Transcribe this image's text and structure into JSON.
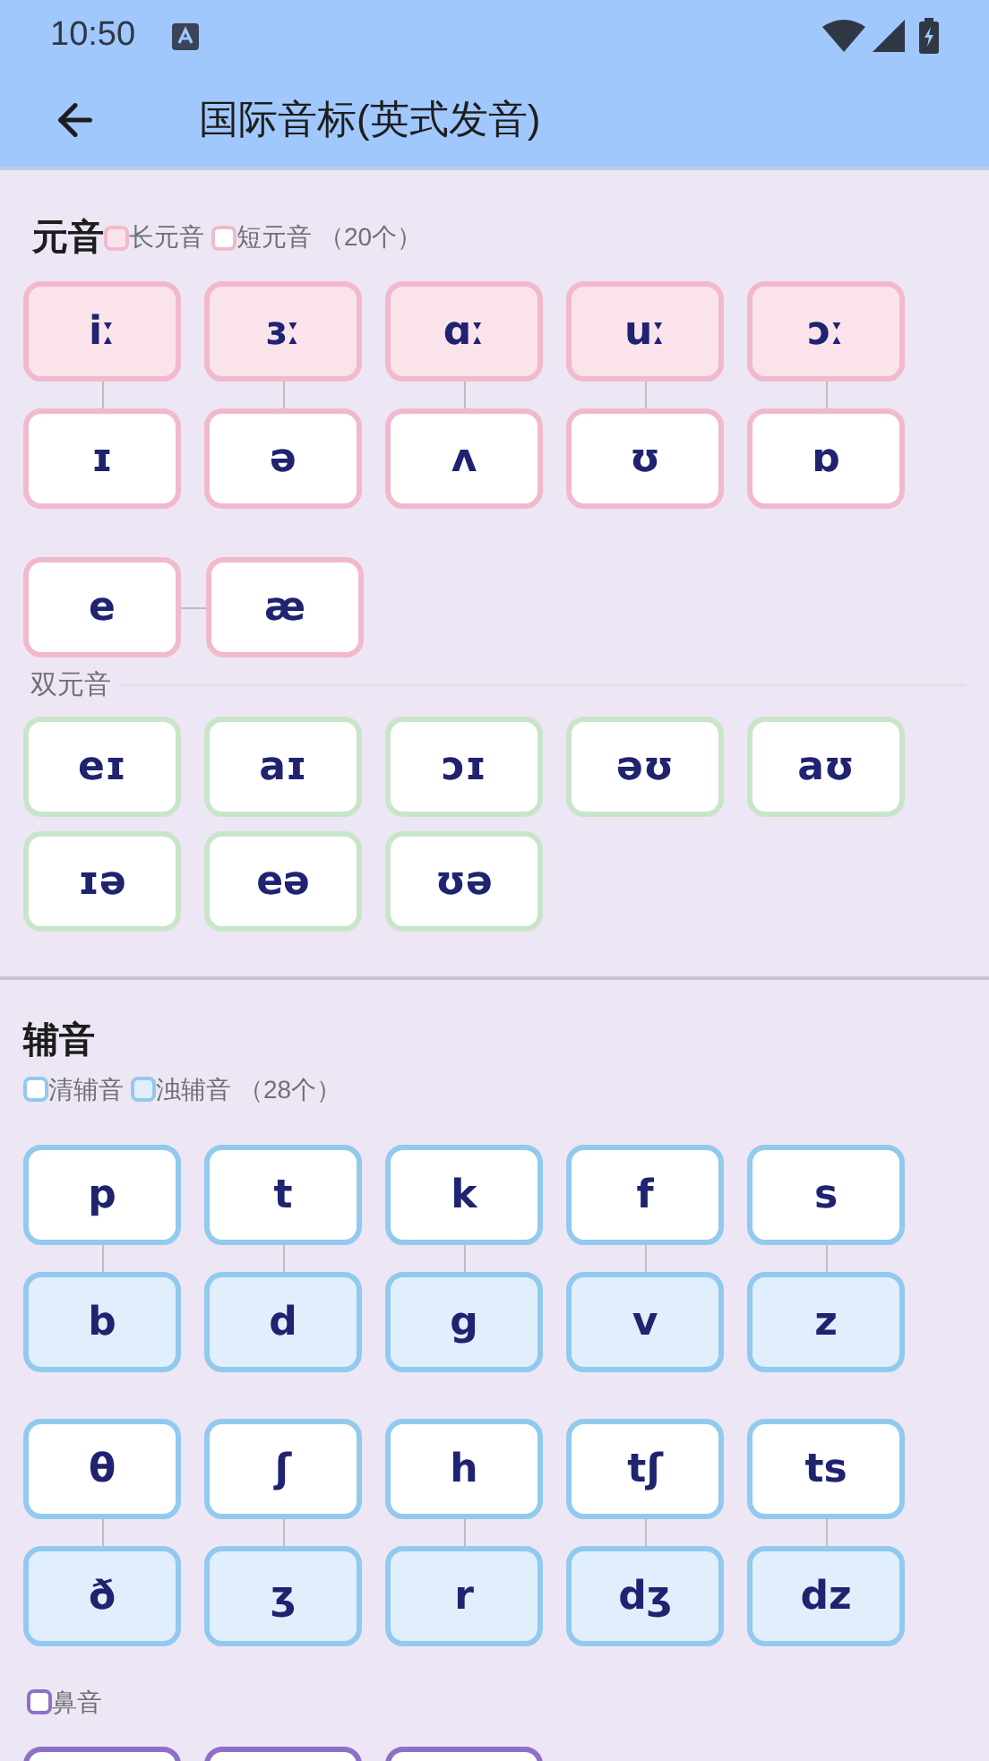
{
  "status_bar": {
    "time": "10:50"
  },
  "header": {
    "title": "国际音标(英式发音)"
  },
  "vowels": {
    "title": "元音",
    "legend": [
      {
        "label": "长元音",
        "kind": "long"
      },
      {
        "label": "短元音",
        "kind": "short"
      }
    ],
    "count": "（20个）",
    "pairs": [
      {
        "top": {
          "symbol": "iː",
          "kind": "long"
        },
        "bottom": {
          "symbol": "ɪ",
          "kind": "short"
        }
      },
      {
        "top": {
          "symbol": "ɜː",
          "kind": "long"
        },
        "bottom": {
          "symbol": "ə",
          "kind": "short"
        }
      },
      {
        "top": {
          "symbol": "ɑː",
          "kind": "long"
        },
        "bottom": {
          "symbol": "ʌ",
          "kind": "short"
        }
      },
      {
        "top": {
          "symbol": "uː",
          "kind": "long"
        },
        "bottom": {
          "symbol": "ʊ",
          "kind": "short"
        }
      },
      {
        "top": {
          "symbol": "ɔː",
          "kind": "long"
        },
        "bottom": {
          "symbol": "ɒ",
          "kind": "short"
        }
      }
    ],
    "linked_pair": [
      {
        "symbol": "e",
        "kind": "short"
      },
      {
        "symbol": "æ",
        "kind": "short"
      }
    ],
    "diphthongs": {
      "label": "双元音",
      "tiles": [
        {
          "symbol": "eɪ",
          "kind": "diphthong"
        },
        {
          "symbol": "aɪ",
          "kind": "diphthong"
        },
        {
          "symbol": "ɔɪ",
          "kind": "diphthong"
        },
        {
          "symbol": "əʊ",
          "kind": "diphthong"
        },
        {
          "symbol": "aʊ",
          "kind": "diphthong"
        },
        {
          "symbol": "ɪə",
          "kind": "diphthong"
        },
        {
          "symbol": "eə",
          "kind": "diphthong"
        },
        {
          "symbol": "ʊə",
          "kind": "diphthong"
        }
      ]
    }
  },
  "consonants": {
    "title": "辅音",
    "legend": [
      {
        "label": "清辅音",
        "kind": "voiceless"
      },
      {
        "label": "浊辅音",
        "kind": "voiced"
      }
    ],
    "count": "（28个）",
    "pair_rows": [
      [
        {
          "top": {
            "symbol": "p",
            "kind": "voiceless"
          },
          "bottom": {
            "symbol": "b",
            "kind": "voiced"
          }
        },
        {
          "top": {
            "symbol": "t",
            "kind": "voiceless"
          },
          "bottom": {
            "symbol": "d",
            "kind": "voiced"
          }
        },
        {
          "top": {
            "symbol": "k",
            "kind": "voiceless"
          },
          "bottom": {
            "symbol": "g",
            "kind": "voiced"
          }
        },
        {
          "top": {
            "symbol": "f",
            "kind": "voiceless"
          },
          "bottom": {
            "symbol": "v",
            "kind": "voiced"
          }
        },
        {
          "top": {
            "symbol": "s",
            "kind": "voiceless"
          },
          "bottom": {
            "symbol": "z",
            "kind": "voiced"
          }
        }
      ],
      [
        {
          "top": {
            "symbol": "θ",
            "kind": "voiceless"
          },
          "bottom": {
            "symbol": "ð",
            "kind": "voiced"
          }
        },
        {
          "top": {
            "symbol": "ʃ",
            "kind": "voiceless"
          },
          "bottom": {
            "symbol": "ʒ",
            "kind": "voiced"
          }
        },
        {
          "top": {
            "symbol": "h",
            "kind": "voiceless"
          },
          "bottom": {
            "symbol": "r",
            "kind": "voiced"
          }
        },
        {
          "top": {
            "symbol": "tʃ",
            "kind": "voiceless"
          },
          "bottom": {
            "symbol": "dʒ",
            "kind": "voiced"
          }
        },
        {
          "top": {
            "symbol": "ts",
            "kind": "voiceless"
          },
          "bottom": {
            "symbol": "dz",
            "kind": "voiced"
          }
        }
      ]
    ],
    "nasal": {
      "legend": [
        {
          "label": "鼻音",
          "kind": "nasal"
        }
      ],
      "tiles": [
        {
          "kind": "nasal"
        },
        {
          "kind": "nasal"
        },
        {
          "kind": "nasal"
        }
      ]
    }
  }
}
